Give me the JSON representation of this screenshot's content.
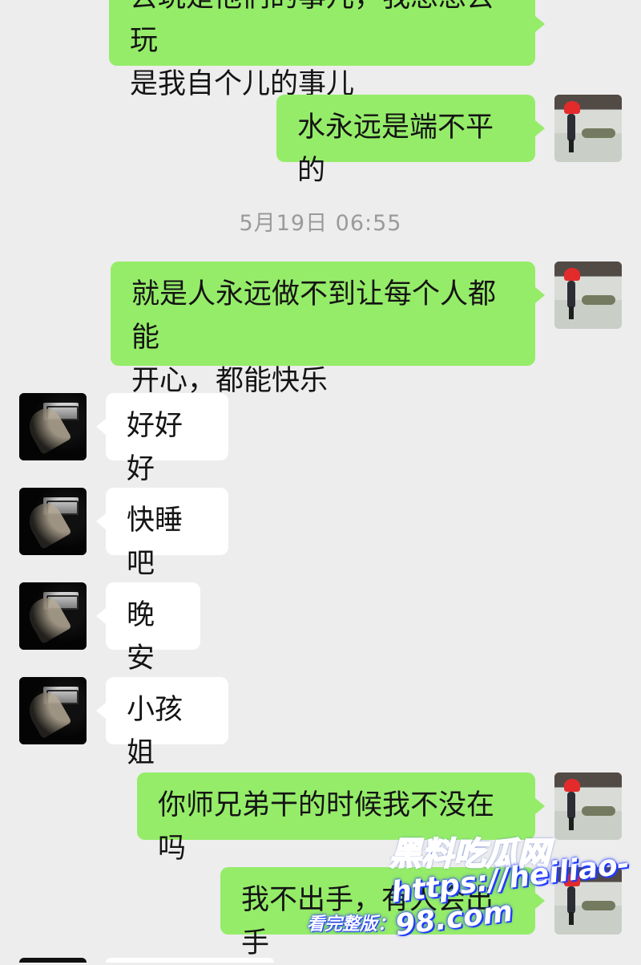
{
  "chat": {
    "timestamp": "5月19日 06:55",
    "messages": [
      {
        "sender": "self",
        "lines": [
          "去玩是他们的事儿，我想想去玩",
          "是我自个儿的事儿"
        ]
      },
      {
        "sender": "self",
        "lines": [
          "水永远是端不平的"
        ]
      },
      {
        "sender": "self",
        "lines": [
          "就是人永远做不到让每个人都能",
          "开心，都能快乐"
        ]
      },
      {
        "sender": "other",
        "lines": [
          "好好好"
        ]
      },
      {
        "sender": "other",
        "lines": [
          "快睡吧"
        ]
      },
      {
        "sender": "other",
        "lines": [
          "晚安"
        ]
      },
      {
        "sender": "other",
        "lines": [
          "小孩姐"
        ]
      },
      {
        "sender": "self",
        "lines": [
          "你师兄弟干的时候我不没在吗"
        ]
      },
      {
        "sender": "self",
        "lines": [
          "我不出手，有人会出手"
        ]
      }
    ]
  },
  "watermark": {
    "logo": "黑料吃瓜网",
    "label": "看完整版：",
    "url": "https://heiliao-98.com"
  },
  "colors": {
    "background": "#ededed",
    "self_bubble": "#95ec69",
    "other_bubble": "#ffffff",
    "timestamp": "#9a9a9a"
  }
}
